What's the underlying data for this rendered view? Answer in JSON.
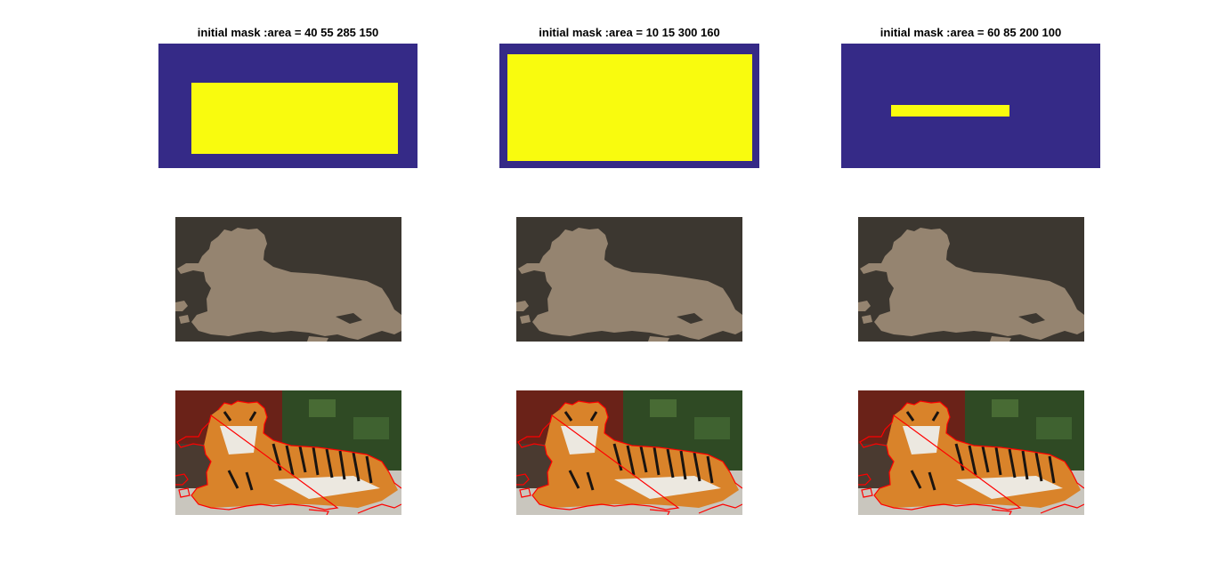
{
  "colors": {
    "mask_background": "#352a87",
    "mask_foreground": "#f9fb0e",
    "segment_background": "#3c3730",
    "segment_foreground": "#958470",
    "contour": "#ff0000",
    "wall": "#6a2218",
    "foliage": "#2f4a24",
    "ground": "#c9c6be",
    "tiger_orange": "#d9832a",
    "tiger_white": "#ece8e0",
    "tiger_stripe": "#1a1410"
  },
  "figure": {
    "row1": [
      {
        "title": "initial mask :area = 40 55 285 150",
        "mask_icon": "rectangle-mask"
      },
      {
        "title": "initial mask :area = 10 15 300 160",
        "mask_icon": "rectangle-mask"
      },
      {
        "title": "initial mask :area = 60 85 200 100",
        "mask_icon": "rectangle-mask"
      }
    ],
    "row2": [
      {
        "icon": "tiger-silhouette-segmentation"
      },
      {
        "icon": "tiger-silhouette-segmentation"
      },
      {
        "icon": "tiger-silhouette-segmentation"
      }
    ],
    "row3": [
      {
        "icon": "tiger-photo-with-contour"
      },
      {
        "icon": "tiger-photo-with-contour"
      },
      {
        "icon": "tiger-photo-with-contour"
      }
    ]
  }
}
